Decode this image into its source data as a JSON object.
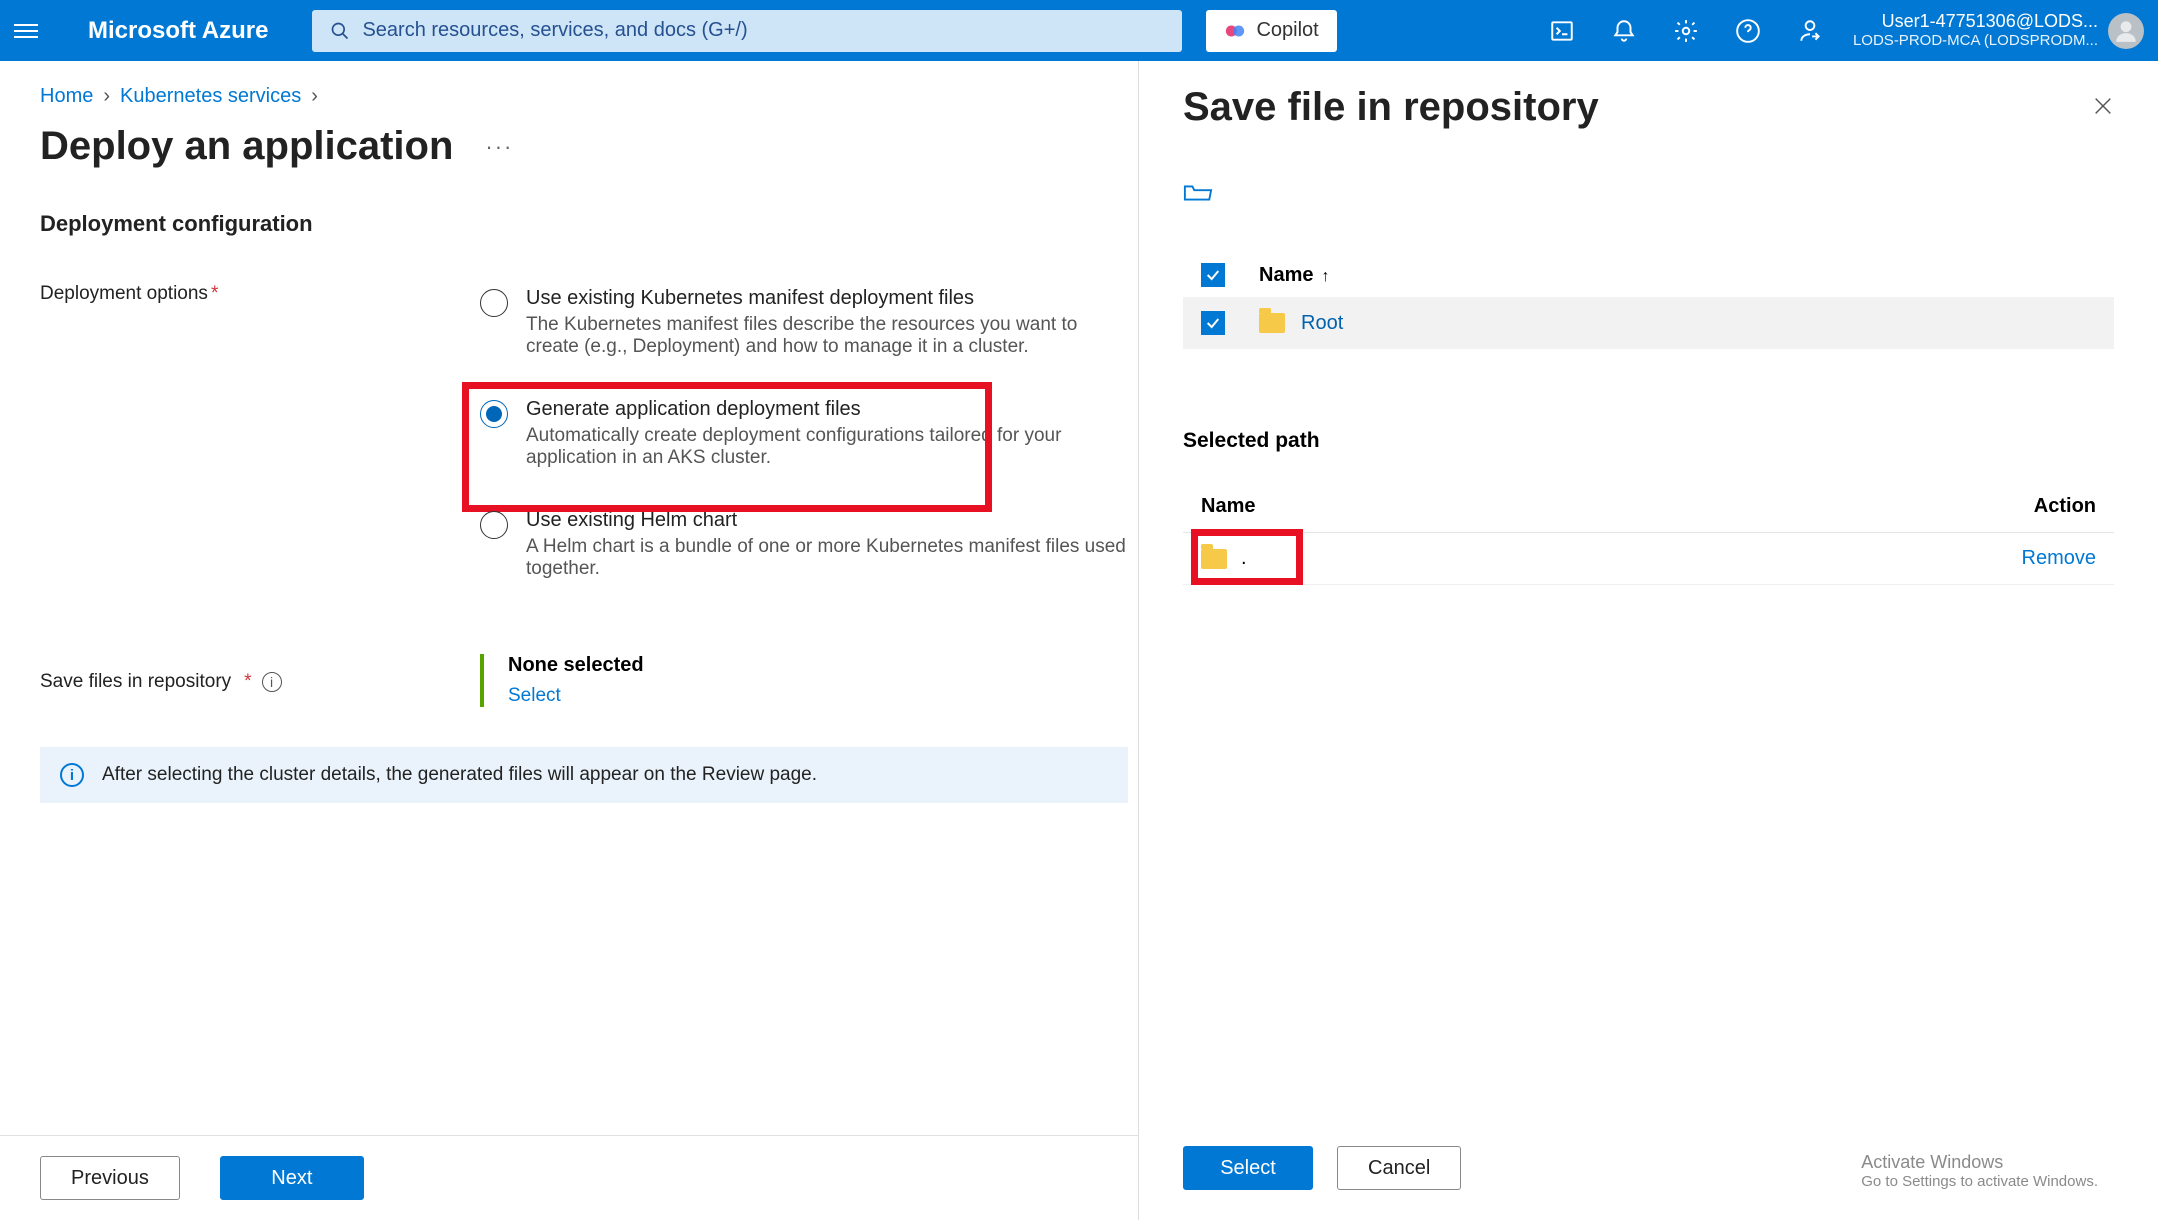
{
  "topbar": {
    "brand": "Microsoft Azure",
    "search_placeholder": "Search resources, services, and docs (G+/)",
    "copilot": "Copilot",
    "user_line1": "User1-47751306@LODS...",
    "user_line2": "LODS-PROD-MCA (LODSPRODM..."
  },
  "breadcrumb": {
    "home": "Home",
    "k8s": "Kubernetes services"
  },
  "page_title": "Deploy an application",
  "section_title": "Deployment configuration",
  "deploy_options_label": "Deployment options",
  "options": {
    "opt1_title": "Use existing Kubernetes manifest deployment files",
    "opt1_desc": "The Kubernetes manifest files describe the resources you want to create (e.g., Deployment) and how to manage it in a cluster.",
    "opt2_title": "Generate application deployment files",
    "opt2_desc": "Automatically create deployment configurations tailored for your application in an AKS cluster.",
    "opt3_title": "Use existing Helm chart",
    "opt3_desc": "A Helm chart is a bundle of one or more Kubernetes manifest files used together."
  },
  "save_label": "Save files in repository",
  "none_selected": "None selected",
  "select_link": "Select",
  "info_banner": "After selecting the cluster details, the generated files will appear on the Review page.",
  "prev_btn": "Previous",
  "next_btn": "Next",
  "panel": {
    "title": "Save file in repository",
    "name_col": "Name",
    "root": "Root",
    "sel_path": "Selected path",
    "action_col": "Action",
    "dot": ".",
    "remove": "Remove",
    "select": "Select",
    "cancel": "Cancel"
  },
  "activation": {
    "l1": "Activate Windows",
    "l2": "Go to Settings to activate Windows."
  }
}
